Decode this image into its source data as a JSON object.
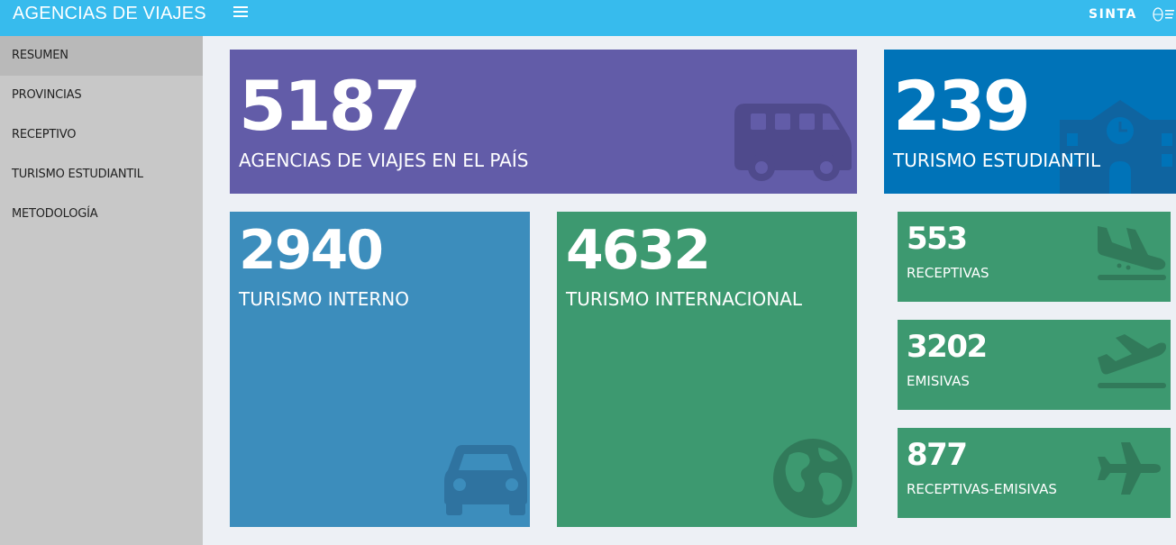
{
  "header": {
    "app_title": "AGENCIAS DE VIAJES",
    "brand": "SINTA",
    "bar_color": "#37bbed",
    "menu_icon": "hamburger-icon",
    "seal_icon": "argentina-seal-icon"
  },
  "sidebar": {
    "items": [
      {
        "label": "RESUMEN",
        "active": true
      },
      {
        "label": "PROVINCIAS",
        "active": false
      },
      {
        "label": "RECEPTIVO",
        "active": false
      },
      {
        "label": "TURISMO ESTUDIANTIL",
        "active": false
      },
      {
        "label": "METODOLOGÍA",
        "active": false
      }
    ]
  },
  "tiles": {
    "agencias": {
      "value": "5187",
      "label": "AGENCIAS DE VIAJES EN EL PAÍS",
      "icon": "bus-icon",
      "color": "#625ca8"
    },
    "estudiantil": {
      "value": "239",
      "label": "TURISMO ESTUDIANTIL",
      "icon": "school-icon",
      "color": "#0073b8"
    },
    "interno": {
      "value": "2940",
      "label": "TURISMO INTERNO",
      "icon": "car-icon",
      "color": "#3c8dbc"
    },
    "internacional": {
      "value": "4632",
      "label": "TURISMO INTERNACIONAL",
      "icon": "globe-icon",
      "color": "#3d9970"
    },
    "receptivas": {
      "value": "553",
      "label": "RECEPTIVAS",
      "icon": "plane-arrival-icon",
      "color": "#3d9970"
    },
    "emisivas": {
      "value": "3202",
      "label": "EMISIVAS",
      "icon": "plane-departure-icon",
      "color": "#3d9970"
    },
    "receptivas_emisivas": {
      "value": "877",
      "label": "RECEPTIVAS-EMISIVAS",
      "icon": "plane-icon",
      "color": "#3d9970"
    }
  }
}
